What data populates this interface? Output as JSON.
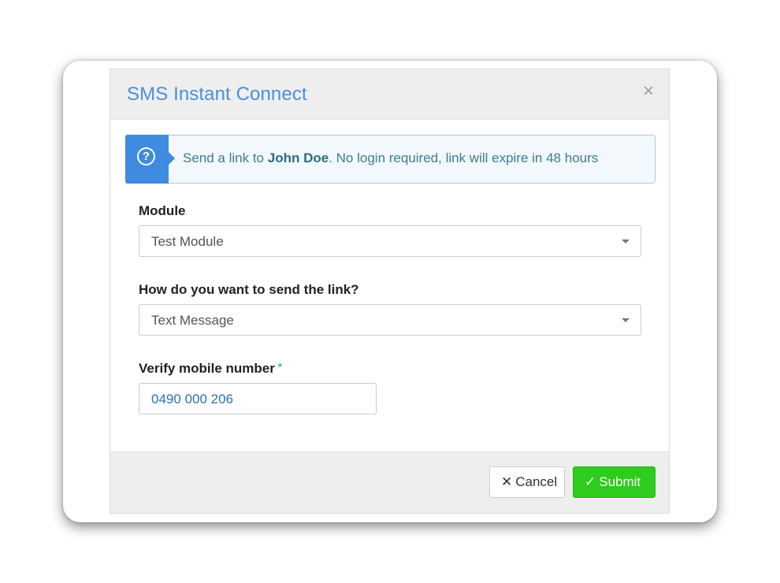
{
  "dialog": {
    "title": "SMS Instant Connect",
    "close_glyph": "×"
  },
  "alert": {
    "icon": "question-circle-icon",
    "prefix": "Send a link to ",
    "name": "John Doe",
    "suffix": ". No login required, link will expire in 48 hours"
  },
  "form": {
    "module": {
      "label": "Module",
      "selected": "Test Module"
    },
    "method": {
      "label": "How do you want to send the link?",
      "selected": "Text Message"
    },
    "mobile": {
      "label": "Verify mobile number",
      "required_mark": "*",
      "value": "0490 000 206"
    }
  },
  "footer": {
    "cancel": {
      "icon_glyph": "✕",
      "label": "Cancel"
    },
    "submit": {
      "icon_glyph": "✓",
      "label": "Submit"
    }
  },
  "colors": {
    "title": "#4a90d9",
    "alert_icon_bg": "#3e8be0",
    "submit_bg": "#2ecc1c"
  }
}
